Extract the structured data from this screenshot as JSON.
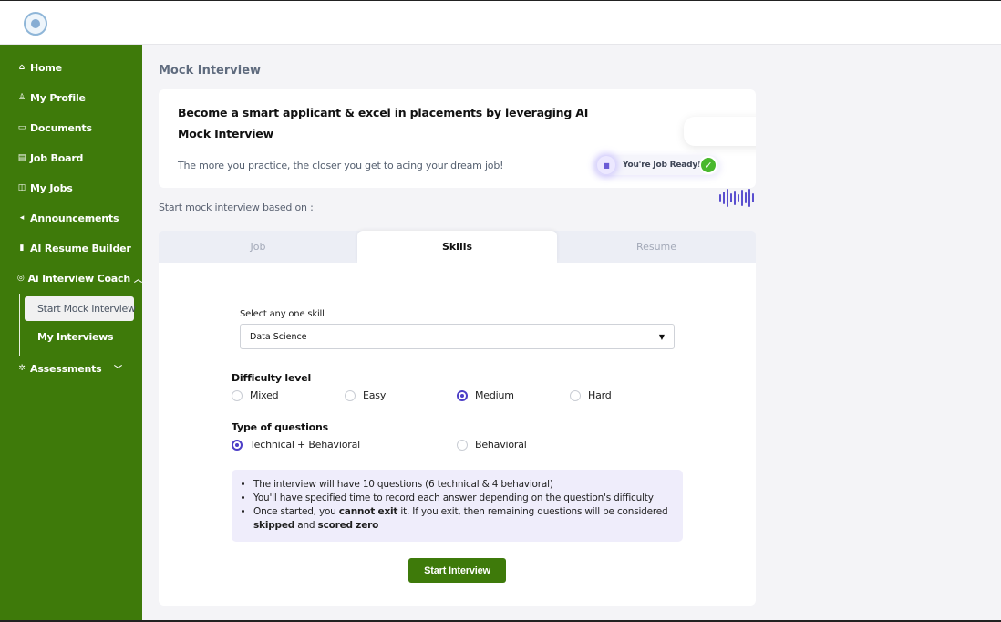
{
  "sidebar": {
    "items": [
      {
        "label": "Home",
        "icon": "home-icon",
        "glyph": "⌂"
      },
      {
        "label": "My Profile",
        "icon": "user-icon",
        "glyph": "♙"
      },
      {
        "label": "Documents",
        "icon": "folder-icon",
        "glyph": "▭"
      },
      {
        "label": "Job Board",
        "icon": "board-icon",
        "glyph": "▤"
      },
      {
        "label": "My Jobs",
        "icon": "briefcase-icon",
        "glyph": "◫"
      },
      {
        "label": "Announcements",
        "icon": "megaphone-icon",
        "glyph": "◂"
      },
      {
        "label": "AI Resume Builder",
        "icon": "resume-icon",
        "glyph": "▮"
      },
      {
        "label": "Ai Interview Coach",
        "icon": "coach-icon",
        "glyph": "◎"
      },
      {
        "label": "Assessments",
        "icon": "assessment-icon",
        "glyph": "✲"
      }
    ],
    "sub_items": [
      "Start Mock Interview",
      "My Interviews"
    ],
    "accent": "#3e7a0a"
  },
  "main": {
    "title": "Mock Interview",
    "banner": {
      "headline": "Become a smart applicant & excel in placements by leveraging AI Mock Interview",
      "subtext": "The more you practice, the closer you get to acing your dream job!",
      "badge": "You're Job Ready!"
    },
    "start_label": "Start mock interview based on :",
    "tabs": [
      "Job",
      "Skills",
      "Resume"
    ],
    "active_tab": "Skills",
    "skill": {
      "label": "Select any one skill",
      "value": "Data Science"
    },
    "difficulty": {
      "label": "Difficulty level",
      "options": [
        "Mixed",
        "Easy",
        "Medium",
        "Hard"
      ],
      "selected": "Medium"
    },
    "question_type": {
      "label": "Type of questions",
      "options": [
        "Technical + Behavioral",
        "Behavioral"
      ],
      "selected": "Technical + Behavioral"
    },
    "info": {
      "line1": "The interview will have 10 questions (6 technical & 4 behavioral)",
      "line2": "You'll have specified time to record each answer depending on the question's difficulty",
      "line3_a": "Once started, you ",
      "line3_b": "cannot exit",
      "line3_c": " it. If you exit, then remaining questions will be considered ",
      "line3_d": "skipped",
      "line3_e": " and ",
      "line3_f": "scored zero"
    },
    "start_button": "Start Interview"
  },
  "colors": {
    "sidebar_green": "#3e7a0a",
    "radio_purple": "#4d3fc7",
    "info_bg": "#efedfb",
    "check_green": "#49b82d"
  }
}
